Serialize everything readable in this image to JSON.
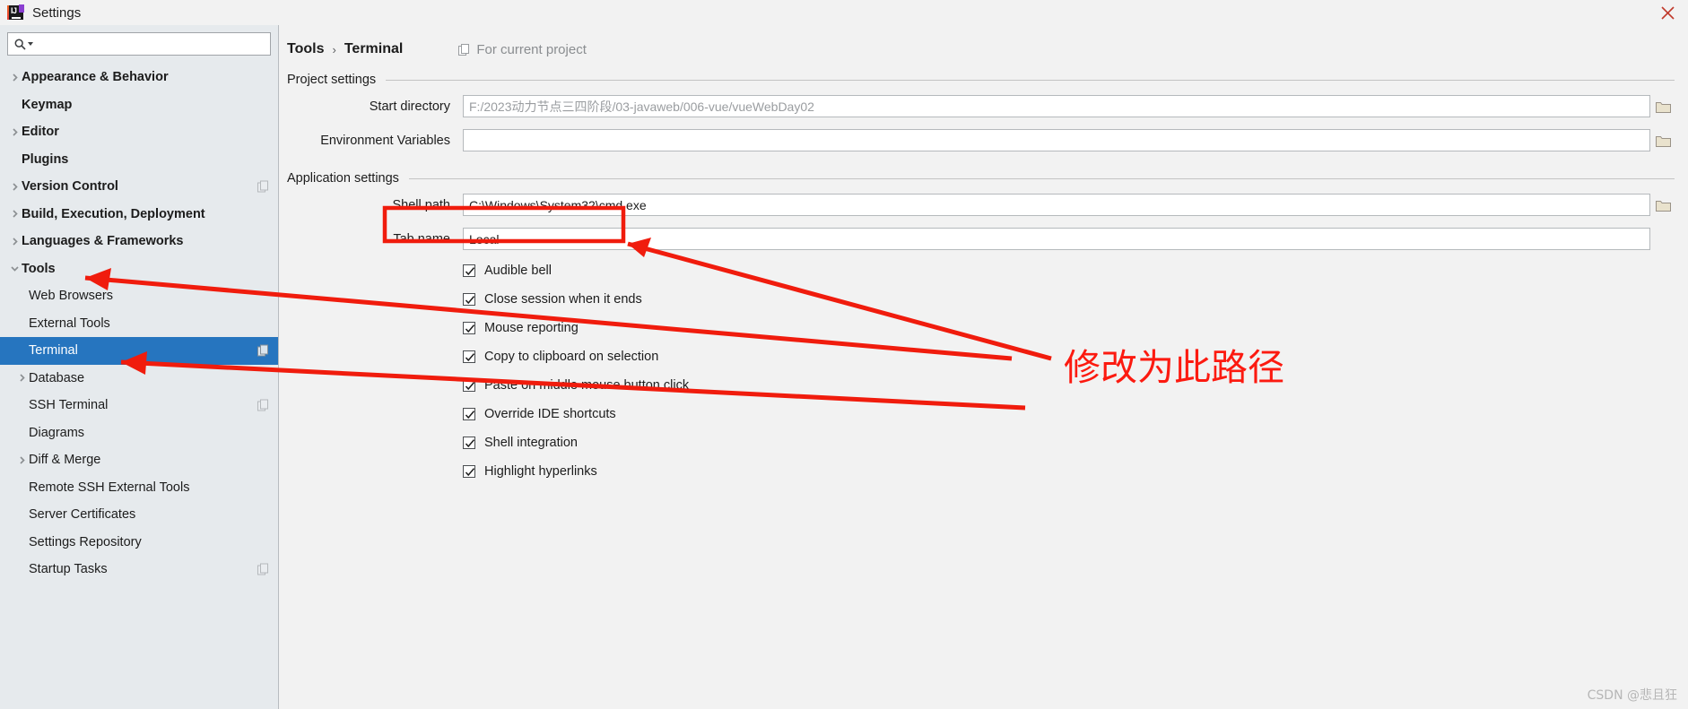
{
  "window": {
    "title": "Settings",
    "logo_icon": "intellij-idea-logo",
    "logo_text": "IJ",
    "close_icon": "close-icon"
  },
  "search": {
    "icon": "search-icon",
    "value": "",
    "placeholder": ""
  },
  "sidebar": {
    "items": [
      {
        "label": "Appearance & Behavior",
        "depth": 0,
        "chevron": "chevron-right-icon",
        "selected": false,
        "badge": false
      },
      {
        "label": "Keymap",
        "depth": 0,
        "chevron": "",
        "selected": false,
        "badge": false
      },
      {
        "label": "Editor",
        "depth": 0,
        "chevron": "chevron-right-icon",
        "selected": false,
        "badge": false
      },
      {
        "label": "Plugins",
        "depth": 0,
        "chevron": "",
        "selected": false,
        "badge": false
      },
      {
        "label": "Version Control",
        "depth": 0,
        "chevron": "chevron-right-icon",
        "selected": false,
        "badge": true
      },
      {
        "label": "Build, Execution, Deployment",
        "depth": 0,
        "chevron": "chevron-right-icon",
        "selected": false,
        "badge": false
      },
      {
        "label": "Languages & Frameworks",
        "depth": 0,
        "chevron": "chevron-right-icon",
        "selected": false,
        "badge": false
      },
      {
        "label": "Tools",
        "depth": 0,
        "chevron": "chevron-down-icon",
        "selected": false,
        "badge": false
      },
      {
        "label": "Web Browsers",
        "depth": 1,
        "chevron": "",
        "selected": false,
        "badge": false
      },
      {
        "label": "External Tools",
        "depth": 1,
        "chevron": "",
        "selected": false,
        "badge": false
      },
      {
        "label": "Terminal",
        "depth": 1,
        "chevron": "",
        "selected": true,
        "badge": true
      },
      {
        "label": "Database",
        "depth": 1,
        "chevron": "chevron-right-icon",
        "selected": false,
        "badge": false
      },
      {
        "label": "SSH Terminal",
        "depth": 1,
        "chevron": "",
        "selected": false,
        "badge": true
      },
      {
        "label": "Diagrams",
        "depth": 1,
        "chevron": "",
        "selected": false,
        "badge": false
      },
      {
        "label": "Diff & Merge",
        "depth": 1,
        "chevron": "chevron-right-icon",
        "selected": false,
        "badge": false
      },
      {
        "label": "Remote SSH External Tools",
        "depth": 1,
        "chevron": "",
        "selected": false,
        "badge": false
      },
      {
        "label": "Server Certificates",
        "depth": 1,
        "chevron": "",
        "selected": false,
        "badge": false
      },
      {
        "label": "Settings Repository",
        "depth": 1,
        "chevron": "",
        "selected": false,
        "badge": false
      },
      {
        "label": "Startup Tasks",
        "depth": 1,
        "chevron": "",
        "selected": false,
        "badge": true
      }
    ]
  },
  "main": {
    "breadcrumb": {
      "parent": "Tools",
      "separator": "›",
      "current": "Terminal",
      "scope_icon": "project-scope-icon",
      "scope_label": "For current project"
    },
    "project_settings": {
      "heading": "Project settings",
      "fields": [
        {
          "label": "Start directory",
          "value": "F:/2023动力节点三四阶段/03-javaweb/006-vue/vueWebDay02",
          "muted": true,
          "browse_icon": "folder-browse-icon"
        },
        {
          "label": "Environment Variables",
          "value": "",
          "muted": false,
          "browse_icon": "folder-browse-icon"
        }
      ]
    },
    "application_settings": {
      "heading": "Application settings",
      "fields": [
        {
          "label": "Shell path",
          "value": "C:\\Windows\\System32\\cmd.exe",
          "muted": false,
          "browse_icon": "folder-browse-icon",
          "highlighted": true
        },
        {
          "label": "Tab name",
          "value": "Local",
          "muted": false,
          "browse_icon": "",
          "highlighted": false
        }
      ],
      "checkboxes": [
        {
          "label": "Audible bell",
          "checked": true
        },
        {
          "label": "Close session when it ends",
          "checked": true
        },
        {
          "label": "Mouse reporting",
          "checked": true
        },
        {
          "label": "Copy to clipboard on selection",
          "checked": true
        },
        {
          "label": "Paste on middle mouse button click",
          "checked": true
        },
        {
          "label": "Override IDE shortcuts",
          "checked": true
        },
        {
          "label": "Shell integration",
          "checked": true
        },
        {
          "label": "Highlight hyperlinks",
          "checked": true
        }
      ]
    }
  },
  "annotations": {
    "note_text": "修改为此路径",
    "accent_color": "#fc1a10",
    "highlight_box_color": "#f01c0d"
  },
  "watermark": "CSDN @悲且狂",
  "colors": {
    "selection_blue": "#2675bf",
    "sidebar_bg": "#e6eaed",
    "panel_bg": "#f2f2f2"
  }
}
